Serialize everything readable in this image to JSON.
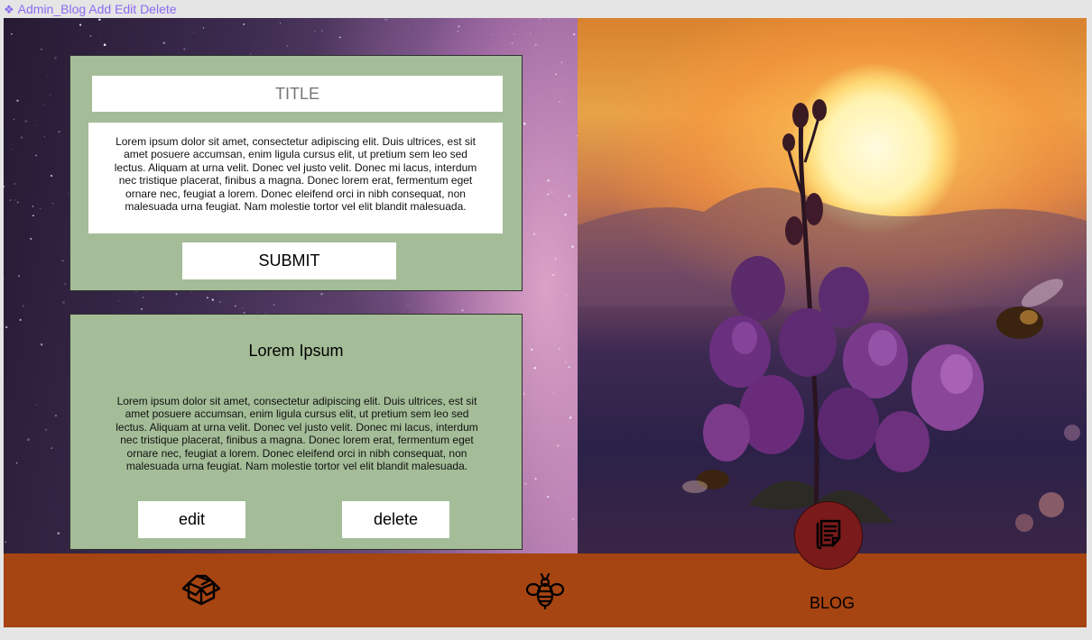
{
  "frame": {
    "label": "Admin_Blog Add Edit Delete"
  },
  "form": {
    "title_placeholder": "TITLE",
    "body_text": "Lorem ipsum dolor sit amet, consectetur adipiscing elit. Duis ultrices, est sit amet posuere accumsan, enim ligula cursus elit, ut pretium sem leo sed lectus. Aliquam at urna velit. Donec vel justo velit. Donec mi lacus, interdum nec tristique placerat, finibus a magna. Donec lorem erat, fermentum eget ornare nec, feugiat a lorem. Donec eleifend orci in nibh consequat, non malesuada urna feugiat. Nam molestie tortor vel elit blandit malesuada.",
    "submit_label": "SUBMIT"
  },
  "post": {
    "title": "Lorem Ipsum",
    "body": "Lorem ipsum dolor sit amet, consectetur adipiscing elit. Duis ultrices, est sit amet posuere accumsan, enim ligula cursus elit, ut pretium sem leo sed lectus. Aliquam at urna velit. Donec vel justo velit. Donec mi lacus, interdum nec tristique placerat, finibus a magna. Donec lorem erat, fermentum eget ornare nec, feugiat a lorem. Donec eleifend orci in nibh consequat, non malesuada urna feugiat. Nam molestie tortor vel elit blandit malesuada.",
    "edit_label": "edit",
    "delete_label": "delete"
  },
  "navbar": {
    "items": [
      {
        "icon": "open-box-icon"
      },
      {
        "icon": "bee-icon"
      },
      {
        "icon": "blog-document-icon",
        "label": "BLOG",
        "active": true
      }
    ]
  },
  "colors": {
    "card_bg": "#a4bd98",
    "navbar_bg": "#a64412",
    "active_circle": "#7a1a1a",
    "frame_label": "#8a6cf0"
  }
}
